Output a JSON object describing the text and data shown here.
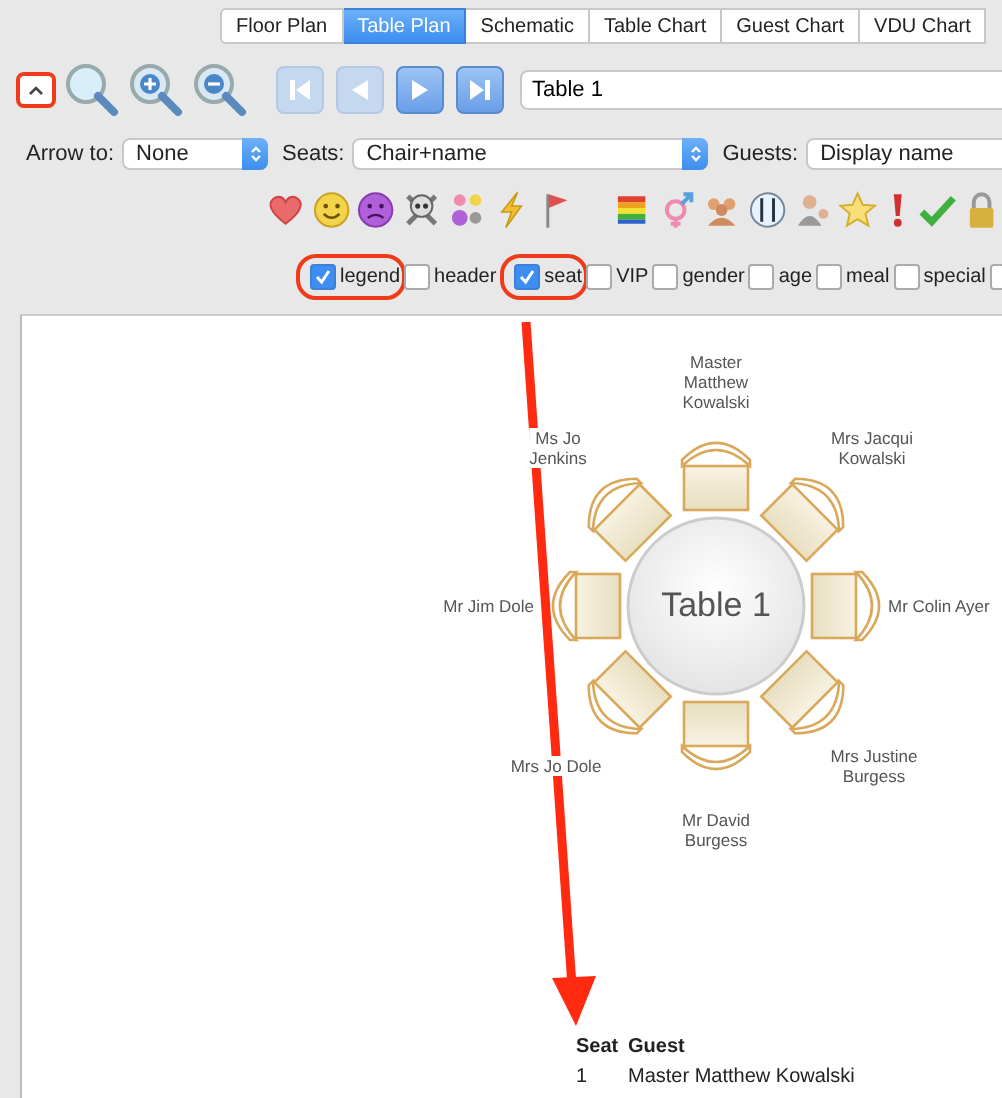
{
  "tabs": [
    {
      "label": "Floor Plan",
      "selected": false
    },
    {
      "label": "Table Plan",
      "selected": true
    },
    {
      "label": "Schematic",
      "selected": false
    },
    {
      "label": "Table Chart",
      "selected": false
    },
    {
      "label": "Guest Chart",
      "selected": false
    },
    {
      "label": "VDU Chart",
      "selected": false
    }
  ],
  "toolbar": {
    "collapse_highlighted": true,
    "table_field": "Table 1",
    "nav_buttons": [
      {
        "kind": "first",
        "disabled": true
      },
      {
        "kind": "prev",
        "disabled": true
      },
      {
        "kind": "next",
        "disabled": false
      },
      {
        "kind": "last",
        "disabled": false
      }
    ]
  },
  "options": [
    {
      "label": "Arrow to:",
      "value": "None"
    },
    {
      "label": "Seats:",
      "value": "Chair+name"
    },
    {
      "label": "Guests:",
      "value": "Display name"
    }
  ],
  "show_checkboxes": [
    {
      "label": "legend",
      "checked": true,
      "highlighted": true
    },
    {
      "label": "header",
      "checked": false,
      "highlighted": false
    },
    {
      "label": "seat",
      "checked": true,
      "highlighted": true
    },
    {
      "label": "VIP",
      "checked": false,
      "highlighted": false
    },
    {
      "label": "gender",
      "checked": false,
      "highlighted": false
    },
    {
      "label": "age",
      "checked": false,
      "highlighted": false
    },
    {
      "label": "meal",
      "checked": false,
      "highlighted": false
    },
    {
      "label": "special",
      "checked": false,
      "highlighted": false
    },
    {
      "checked": false,
      "highlighted": false
    }
  ],
  "plan": {
    "table_name": "Table 1",
    "seats": [
      {
        "lines": [
          "Master",
          "Matthew",
          "Kowalski"
        ]
      },
      {
        "lines": [
          "Mrs Jacqui",
          "Kowalski"
        ]
      },
      {
        "lines": [
          "Mr Colin Ayer"
        ]
      },
      {
        "lines": [
          "Mrs Justine",
          "Burgess"
        ]
      },
      {
        "lines": [
          "Mr David",
          "Burgess"
        ]
      },
      {
        "lines": [
          "Mrs Jo Dole"
        ]
      },
      {
        "lines": [
          "Mr Jim Dole"
        ]
      },
      {
        "lines": [
          "Ms Jo",
          "Jenkins"
        ]
      }
    ]
  },
  "legend": {
    "headers": [
      "Seat",
      "Guest"
    ],
    "rows": [
      [
        "1",
        "Master Matthew Kowalski"
      ]
    ]
  }
}
